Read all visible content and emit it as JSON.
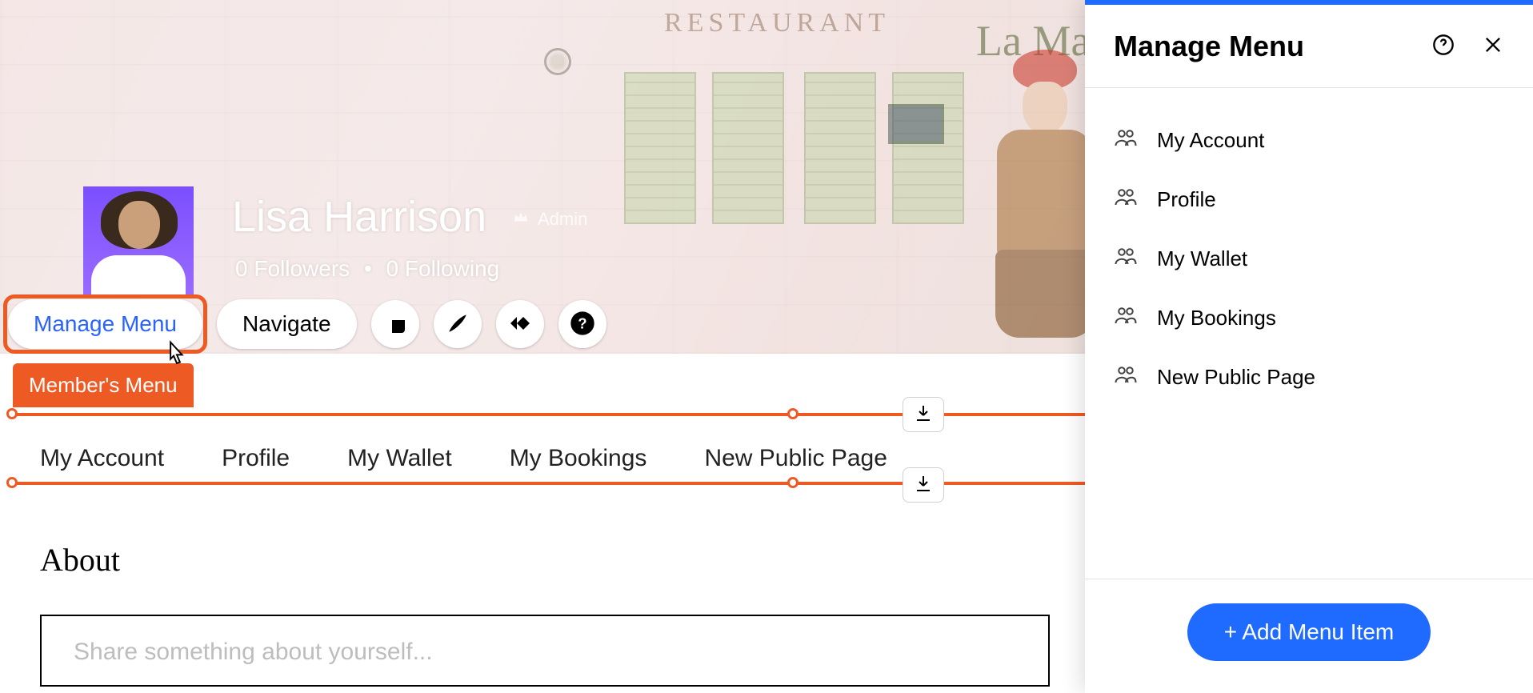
{
  "profile": {
    "name": "Lisa Harrison",
    "role": "Admin",
    "followers_count": "0",
    "followers_label": "Followers",
    "following_count": "0",
    "following_label": "Following"
  },
  "scene": {
    "restaurant": "RESTAURANT",
    "lamaison": "La Mais"
  },
  "toolbar": {
    "manage_menu": "Manage Menu",
    "navigate": "Navigate"
  },
  "members_menu": {
    "tag": "Member's Menu",
    "tabs": [
      "My Account",
      "Profile",
      "My Wallet",
      "My Bookings",
      "New Public Page"
    ]
  },
  "about": {
    "heading": "About",
    "placeholder": "Share something about yourself..."
  },
  "panel": {
    "title": "Manage Menu",
    "items": [
      "My Account",
      "Profile",
      "My Wallet",
      "My Bookings",
      "New Public Page"
    ],
    "add_label": "+ Add Menu Item"
  }
}
